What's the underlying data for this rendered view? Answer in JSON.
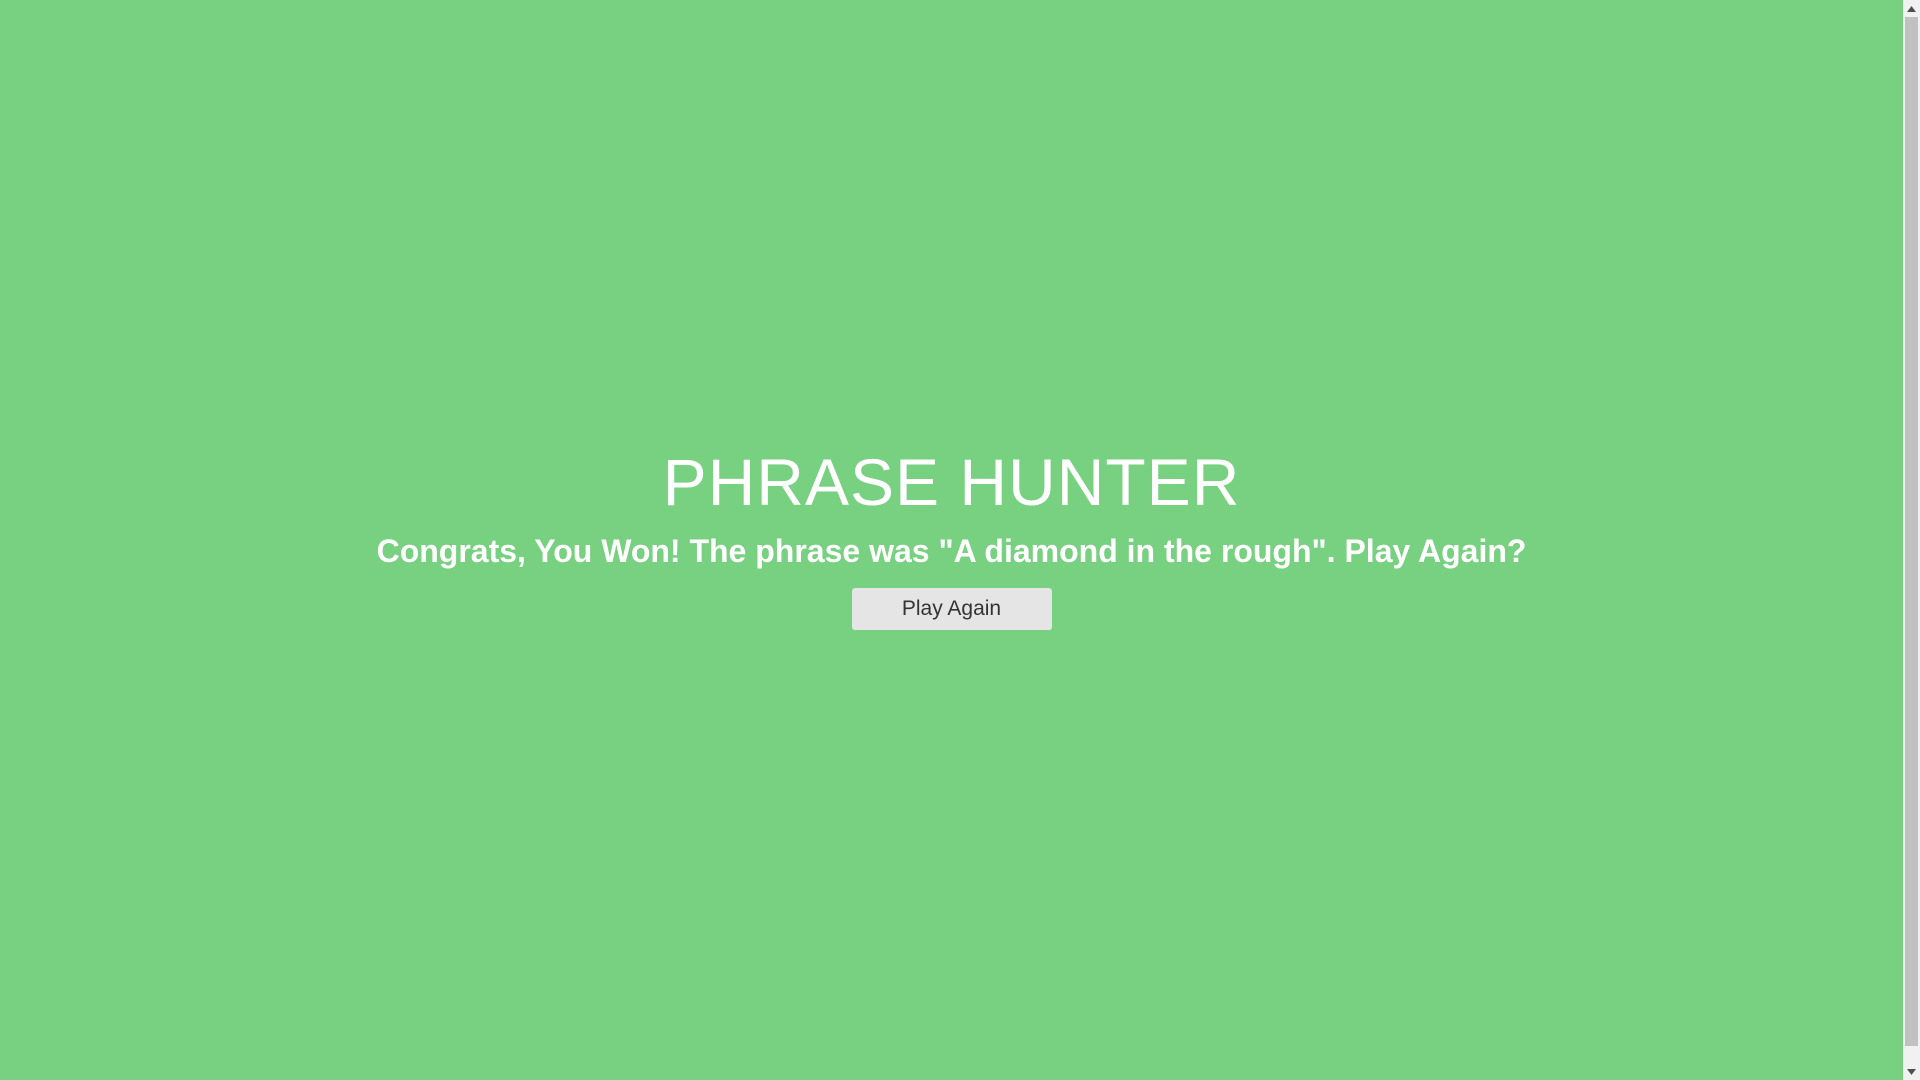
{
  "game": {
    "title": "PHRASE HUNTER",
    "message": "Congrats, You Won! The phrase was \"A diamond in the rough\". Play Again?",
    "button_label": "Play Again",
    "background_color": "#78d081"
  },
  "scrollbar": {
    "up_icon": "chevron-up-icon",
    "down_icon": "chevron-down-icon"
  }
}
